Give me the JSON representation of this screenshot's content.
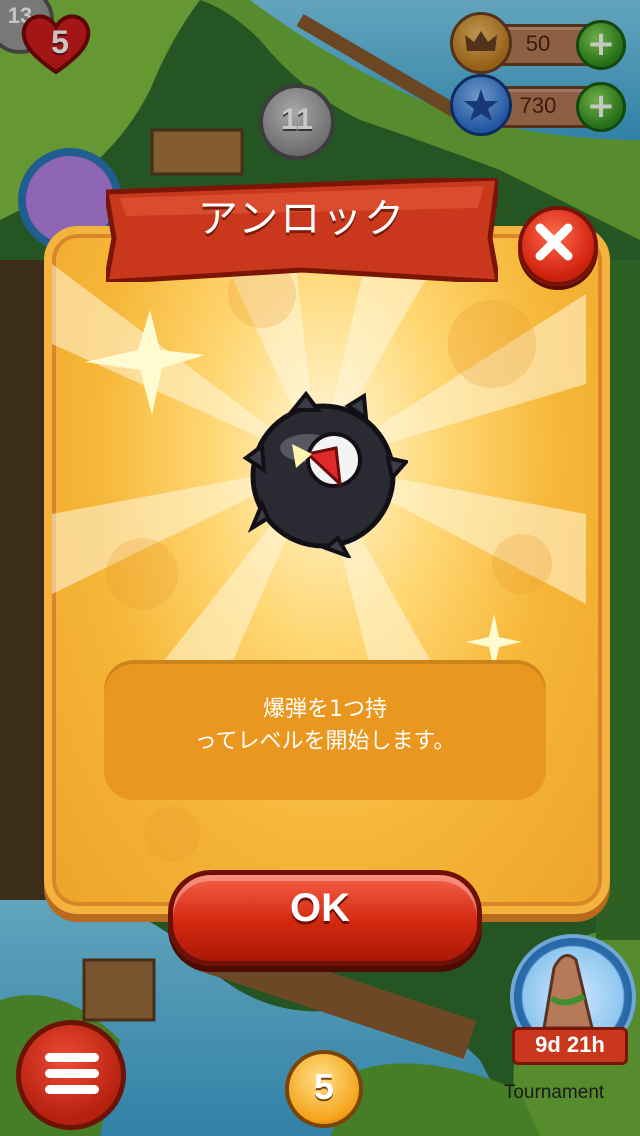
{
  "hud": {
    "lives": "5",
    "level_partial": "13",
    "crowns": "50",
    "stars": "730"
  },
  "map": {
    "level_current": "11",
    "level_bottom": "5",
    "tournament_timer": "9d 21h",
    "tournament_label": "Tournament"
  },
  "dialog": {
    "title": "アンロック",
    "description_line1": "爆弾を1つ持",
    "description_line2": "ってレベルを開始します。",
    "ok_label": "OK"
  },
  "icons": {
    "crown": "crown-icon",
    "star": "star-icon",
    "plus": "plus-icon",
    "close": "close-icon",
    "bomb": "bomb-icon",
    "menu": "menu-icon",
    "heart": "heart-icon"
  },
  "colors": {
    "dialog_bg": "#f6b637",
    "title_banner": "#c9371c",
    "ok_button": "#d3280f",
    "plus_button": "#2e8d1e"
  }
}
